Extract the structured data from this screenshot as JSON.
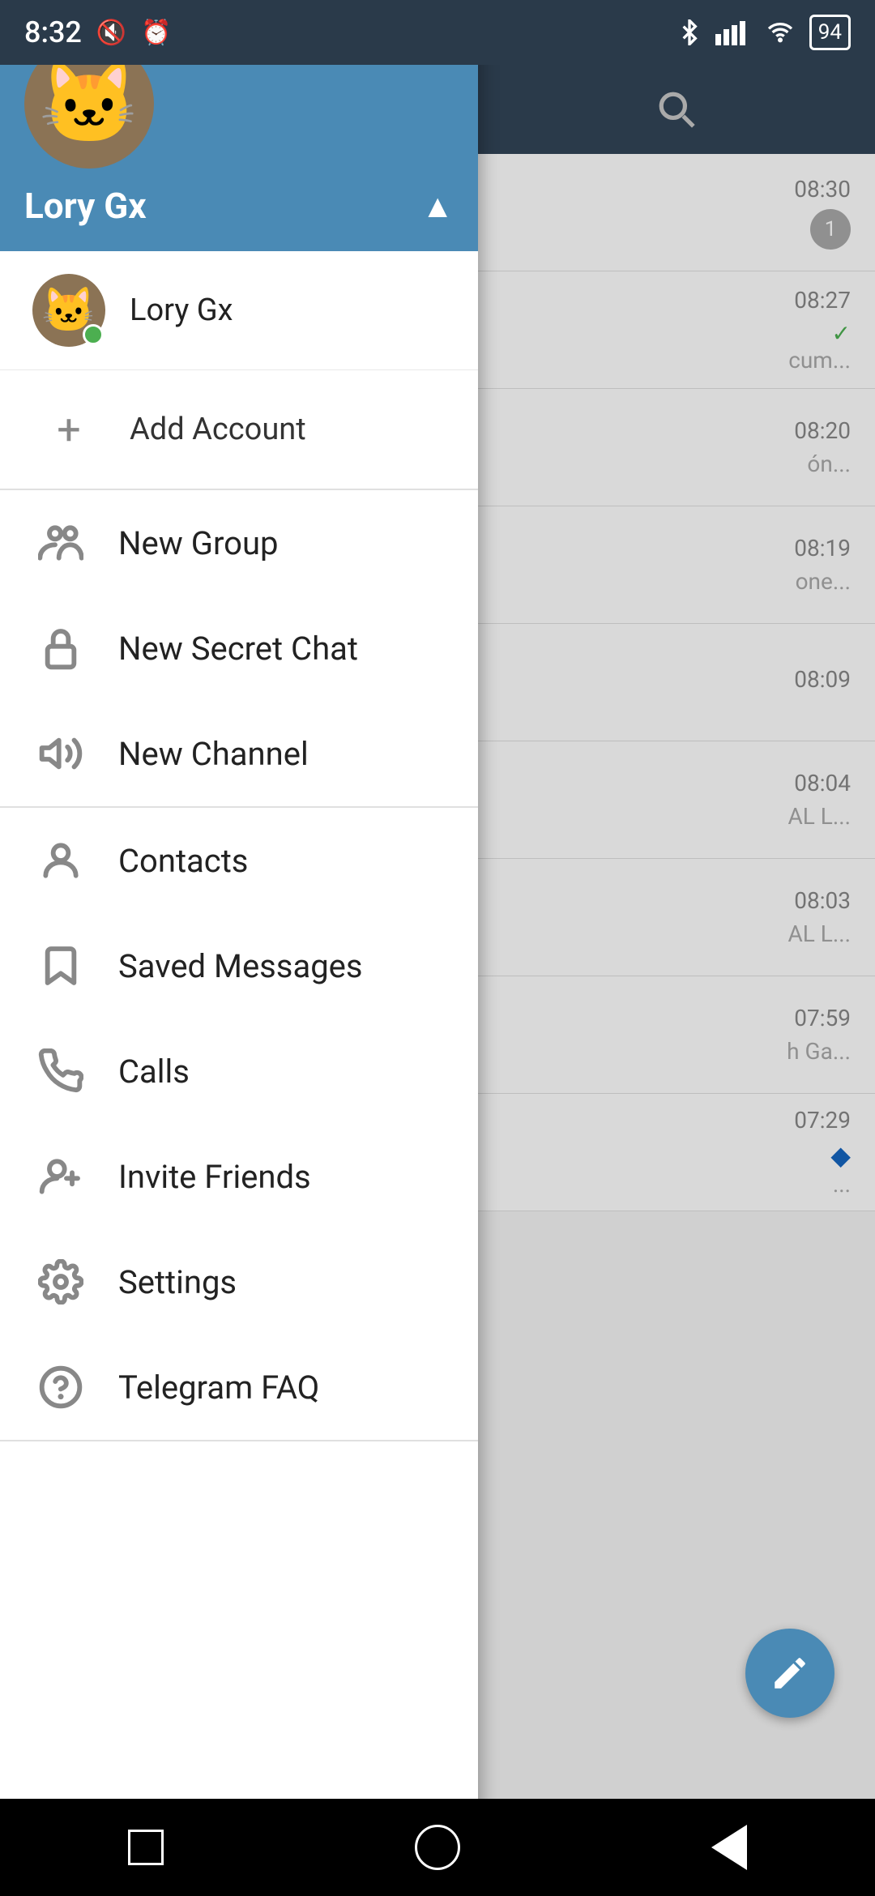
{
  "status": {
    "time": "8:32",
    "battery": "94",
    "icons": {
      "mute": "🔇",
      "alarm": "⏰",
      "bluetooth": "⚡",
      "wifi": "WiFi",
      "signal": "Signal"
    }
  },
  "search_icon": "🔍",
  "chat_list": [
    {
      "time": "08:30",
      "preview": "...",
      "badge": "1"
    },
    {
      "time": "08:27",
      "preview": "cum...",
      "check": true
    },
    {
      "time": "08:20",
      "preview": "ón..."
    },
    {
      "time": "08:19",
      "preview": "one..."
    },
    {
      "time": "08:09",
      "preview": ""
    },
    {
      "time": "08:04",
      "preview": "AL L..."
    },
    {
      "time": "08:03",
      "preview": "AL L..."
    },
    {
      "time": "07:59",
      "preview": "h Ga..."
    },
    {
      "time": "07:29",
      "preview": "..."
    }
  ],
  "drawer": {
    "user_name": "Lory Gx",
    "account_name": "Lory Gx",
    "add_account_label": "Add Account"
  },
  "menu": {
    "section1": [
      {
        "id": "new-group",
        "label": "New Group"
      },
      {
        "id": "new-secret-chat",
        "label": "New Secret Chat"
      },
      {
        "id": "new-channel",
        "label": "New Channel"
      }
    ],
    "section2": [
      {
        "id": "contacts",
        "label": "Contacts"
      },
      {
        "id": "saved-messages",
        "label": "Saved Messages"
      },
      {
        "id": "calls",
        "label": "Calls"
      },
      {
        "id": "invite-friends",
        "label": "Invite Friends"
      },
      {
        "id": "settings",
        "label": "Settings"
      },
      {
        "id": "telegram-faq",
        "label": "Telegram FAQ"
      }
    ]
  },
  "nav": {
    "square": "■",
    "circle": "●",
    "back": "◀"
  }
}
